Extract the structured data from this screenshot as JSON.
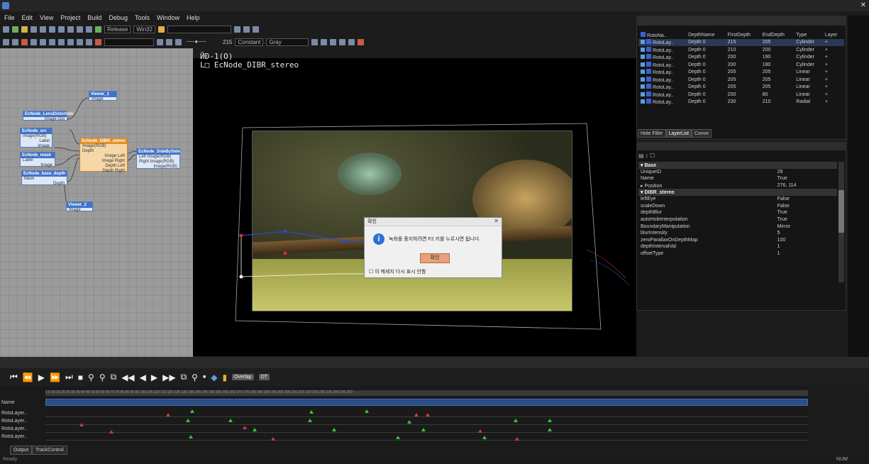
{
  "menu": [
    "File",
    "Edit",
    "View",
    "Project",
    "Build",
    "Debug",
    "Tools",
    "Window",
    "Help"
  ],
  "toolbar": {
    "config": "Release",
    "platform": "Win32",
    "zoom_value": "215",
    "interp": "Constant",
    "color_mode": "Gray"
  },
  "viewport_text": {
    "line1": "ЙÐ-1(О)",
    "line2": "L□ EcNode_DIBR_stereo"
  },
  "dialog": {
    "title": "확인",
    "message": "녹화를 중지하려면 F2 키를 누르시면 됩니다.",
    "ok": "확인",
    "checkbox": "이 메세지 다시 표시 안함"
  },
  "layer_table": {
    "headers": [
      "RotoNa..",
      "DepthName",
      "FirstDepth",
      "EndDepth",
      "Type",
      "Layer"
    ],
    "rows": [
      [
        "RotoLay..",
        "Depth 0",
        "215",
        "205",
        "Cylinder",
        "+"
      ],
      [
        "RotoLay..",
        "Depth 0",
        "210",
        "200",
        "Cylinder",
        "+"
      ],
      [
        "RotoLay..",
        "Depth 0",
        "200",
        "190",
        "Cylinder",
        "+"
      ],
      [
        "RotoLay..",
        "Depth 0",
        "200",
        "180",
        "Cylinder",
        "+"
      ],
      [
        "RotoLay..",
        "Depth 0",
        "205",
        "205",
        "Linear",
        "+"
      ],
      [
        "RotoLay..",
        "Depth 0",
        "205",
        "205",
        "Linear",
        "+"
      ],
      [
        "RotoLay..",
        "Depth 0",
        "205",
        "205",
        "Linear",
        "+"
      ],
      [
        "RotoLay..",
        "Depth 0",
        "200",
        "80",
        "Linear",
        "+"
      ],
      [
        "RotoLay..",
        "Depth 0",
        "230",
        "210",
        "Radial",
        "+"
      ]
    ]
  },
  "layer_tabs": [
    "Hole Filler",
    "LayerList",
    "Conve"
  ],
  "properties": {
    "sec_base": "Base",
    "uid_k": "UniqueID",
    "uid_v": "29",
    "name_k": "Name",
    "name_v": "True",
    "pos_k": "Position",
    "pos_v": "276, 114",
    "sec_dibr": "DIBR_stereo",
    "le_k": "leftEye",
    "le_v": "False",
    "sd_k": "scaleDown",
    "sd_v": "False",
    "db_k": "depthBlur",
    "db_v": "True",
    "ah_k": "autoHoleInterpolation",
    "ah_v": "True",
    "bm_k": "BoundaryManipulation",
    "bm_v": "Mirror",
    "bi_k": "blurIntensity",
    "bi_v": "5",
    "zp_k": "zeroParallaxOnDepthMap",
    "zp_v": "100",
    "di_k": "depthIntervalVal",
    "di_v": "1",
    "ot_k": "offsetType",
    "ot_v": "1"
  },
  "nodes": {
    "viewer1": "Viewer_1",
    "viewer1_p": "Image",
    "lens": "EcNode_LensDistortion",
    "lens_p": "Image Out",
    "src": "EcNode_src",
    "src_p1": "Image(RGB)",
    "src_p2": "Label",
    "src_p3": "Image",
    "mask": "EcNode_mask",
    "mask_p1": "Label",
    "mask_p2": "Image",
    "depth": "EcNode_base_depth",
    "depth_p1": "Mask",
    "depth_p2": "Depth",
    "dibr": "EcNode_DIBR_stereo",
    "dibr_p1": "Image(RGB)",
    "dibr_p2": "Depth",
    "dibr_p3": "Image Left",
    "dibr_p4": "Image Right",
    "dibr_p5": "Depth Left",
    "dibr_p6": "Depth Right",
    "sbs": "EcNode_SideBySide",
    "sbs_p1": "Left Image(RGB)",
    "sbs_p2": "Right Image(RGB)",
    "sbs_p3": "Image(RGB)",
    "viewer2": "Viewer_2",
    "viewer2_p": "Image"
  },
  "timeline": {
    "buttons": [
      "Overlap",
      "DT"
    ],
    "name_header": "Name",
    "rows": [
      "RotoLayer..",
      "RotoLayer..",
      "RotoLayer..",
      "RotoLayer.."
    ],
    "ruler": "1 5 10 15 20 25 30 35 40 45 50 55 60 65 70 75 80 85 90 95 100 105 110 115 120 125 130 135 140 145 150 155 160 165 170 175 180 185 190 195 200 205 210 215 220 225 230 235 240 245 250"
  },
  "bottom_tabs": [
    "Output",
    "TrackControl"
  ],
  "status": {
    "left": "Ready",
    "right": "NUM"
  }
}
